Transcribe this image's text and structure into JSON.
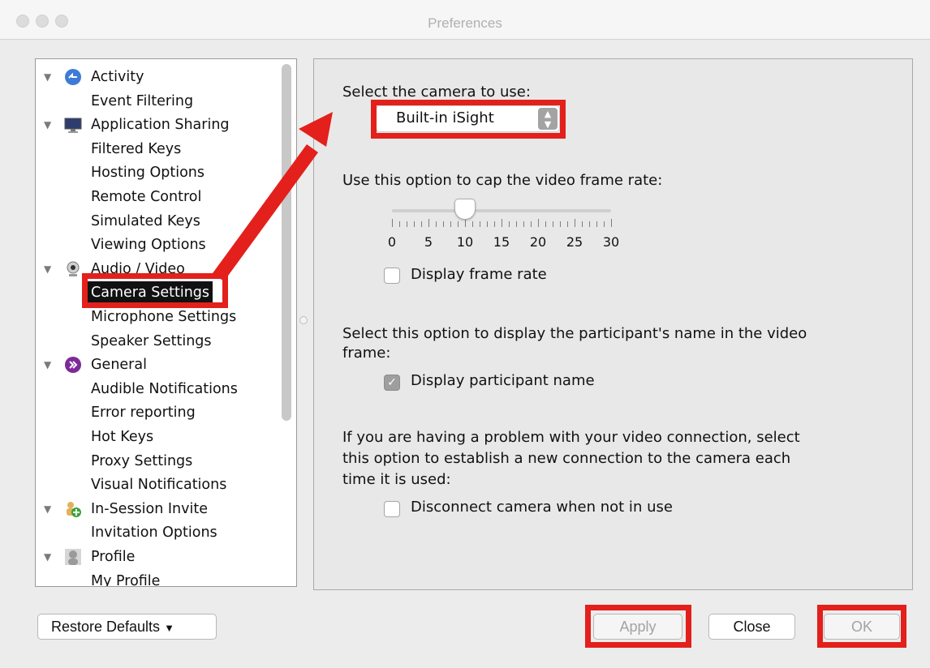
{
  "window": {
    "title": "Preferences"
  },
  "tree": [
    {
      "label": "Activity",
      "level": 0,
      "icon": "activity-icon"
    },
    {
      "label": "Event Filtering",
      "level": 1
    },
    {
      "label": "Application Sharing",
      "level": 0,
      "icon": "monitor-icon"
    },
    {
      "label": "Filtered Keys",
      "level": 1
    },
    {
      "label": "Hosting Options",
      "level": 1
    },
    {
      "label": "Remote Control",
      "level": 1
    },
    {
      "label": "Simulated Keys",
      "level": 1
    },
    {
      "label": "Viewing Options",
      "level": 1
    },
    {
      "label": "Audio / Video",
      "level": 0,
      "icon": "webcam-icon"
    },
    {
      "label": "Camera Settings",
      "level": 1,
      "selected": true
    },
    {
      "label": "Microphone Settings",
      "level": 1
    },
    {
      "label": "Speaker Settings",
      "level": 1
    },
    {
      "label": "General",
      "level": 0,
      "icon": "general-icon"
    },
    {
      "label": "Audible Notifications",
      "level": 1
    },
    {
      "label": "Error reporting",
      "level": 1
    },
    {
      "label": "Hot Keys",
      "level": 1
    },
    {
      "label": "Proxy Settings",
      "level": 1
    },
    {
      "label": "Visual Notifications",
      "level": 1
    },
    {
      "label": "In-Session Invite",
      "level": 0,
      "icon": "invite-icon"
    },
    {
      "label": "Invitation Options",
      "level": 1
    },
    {
      "label": "Profile",
      "level": 0,
      "icon": "profile-icon"
    },
    {
      "label": "My Profile",
      "level": 1
    }
  ],
  "camera": {
    "select_prompt": "Select the camera to use:",
    "selected_camera": "Built-in iSight",
    "frame_rate_prompt": "Use this option to cap the video frame rate:",
    "frame_rate_value": 10,
    "slider_labels": [
      "0",
      "5",
      "10",
      "15",
      "20",
      "25",
      "30"
    ],
    "display_frame_rate": {
      "label": "Display frame rate",
      "checked": false
    },
    "participant_prompt_line1": "Select this option to display the participant's name in the video",
    "participant_prompt_line2": "frame:",
    "display_participant_name": {
      "label": "Display participant name",
      "checked": true
    },
    "reconnect_prompt_line1": "If you are having a problem with your video connection, select",
    "reconnect_prompt_line2": "this option to establish a new connection to the camera each",
    "reconnect_prompt_line3": "time it is used:",
    "disconnect_camera": {
      "label": "Disconnect camera when not in use",
      "checked": false
    }
  },
  "buttons": {
    "restore_defaults": "Restore Defaults",
    "apply": "Apply",
    "close": "Close",
    "ok": "OK"
  },
  "colors": {
    "highlight_box": "#e3201b",
    "arrow": "#e3201b",
    "selection": "#111111"
  }
}
